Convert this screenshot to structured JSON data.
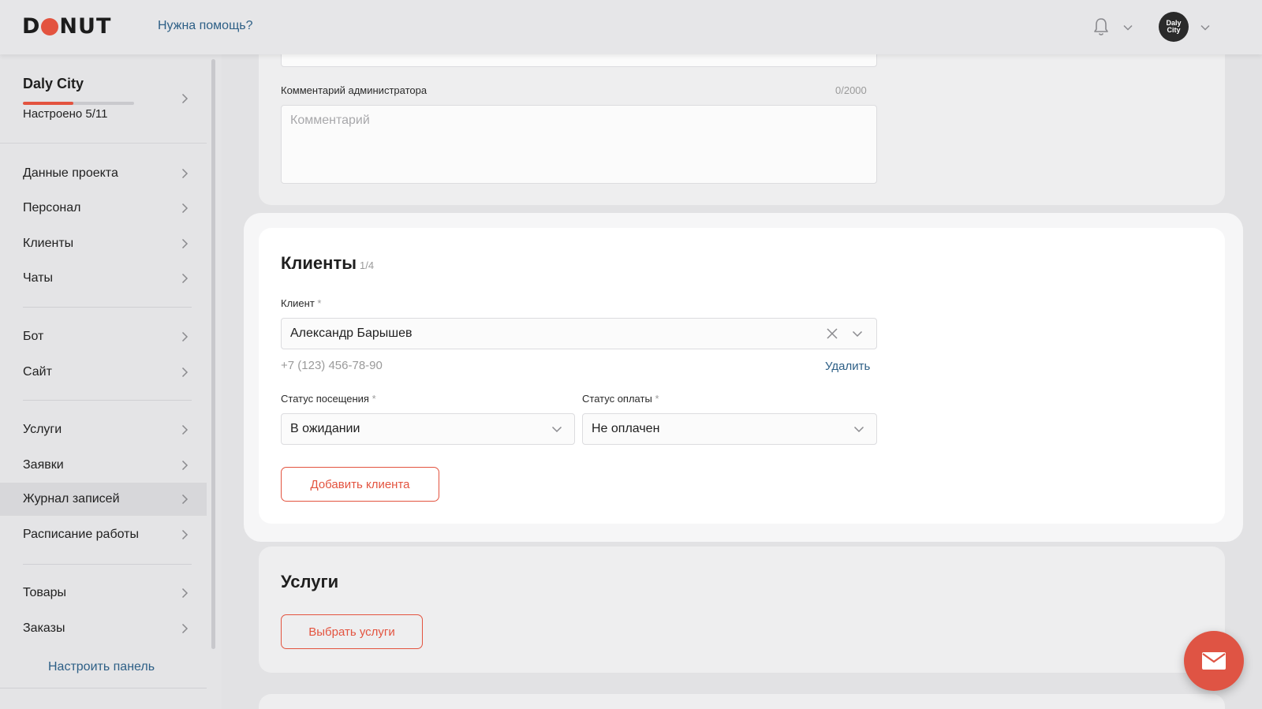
{
  "header": {
    "logo_left": "D",
    "logo_right": "NUT",
    "help": "Нужна помощь?",
    "avatar_text_1": "Daly",
    "avatar_text_2": "City"
  },
  "sidebar": {
    "project": {
      "name": "Daly City",
      "setup_status": "Настроено 5/11",
      "progress_fraction": 0.4545
    },
    "items": [
      {
        "label": "Данные проекта"
      },
      {
        "label": "Персонал"
      },
      {
        "label": "Клиенты"
      },
      {
        "label": "Чаты"
      },
      {
        "label": "Бот"
      },
      {
        "label": "Сайт"
      },
      {
        "label": "Услуги"
      },
      {
        "label": "Заявки"
      },
      {
        "label": "Журнал записей",
        "active": true
      },
      {
        "label": "Расписание работы"
      },
      {
        "label": "Товары"
      },
      {
        "label": "Заказы"
      }
    ],
    "customize": "Настроить панель"
  },
  "admin_comment": {
    "label": "Комментарий администратора",
    "counter": "0/2000",
    "placeholder": "Комментарий"
  },
  "clients": {
    "title": "Клиенты",
    "count": "1/4",
    "client_label": "Клиент",
    "required_mark": "*",
    "client_value": "Александр Барышев",
    "phone": "+7 (123) 456-78-90",
    "remove": "Удалить",
    "visit_status_label": "Статус посещения",
    "visit_status_value": "В ожидании",
    "payment_status_label": "Статус оплаты",
    "payment_status_value": "Не оплачен",
    "add_button": "Добавить клиента"
  },
  "services": {
    "title": "Услуги",
    "select_button": "Выбрать услуги"
  },
  "colors": {
    "accent": "#e3533f",
    "link": "#2d5f86"
  }
}
